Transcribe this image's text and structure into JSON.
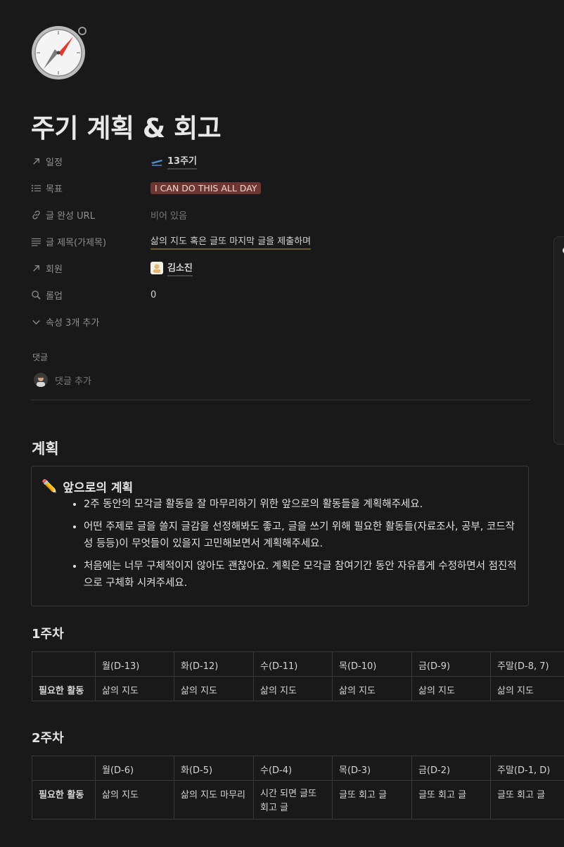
{
  "page": {
    "title": "주기 계획 & 회고"
  },
  "properties": [
    {
      "key": "일정",
      "icon": "arrow-upright-icon",
      "value": "13주기",
      "value_icon": "airplane-icon"
    },
    {
      "key": "목표",
      "icon": "list-icon",
      "value": "I CAN DO THIS ALL DAY"
    },
    {
      "key": "글 완성 URL",
      "icon": "link-icon",
      "value": "비어 있음"
    },
    {
      "key": "글 제목(가제목)",
      "icon": "text-lines-icon",
      "value": "삶의 지도 혹은 글또 마지막 글을 제출하며"
    },
    {
      "key": "회원",
      "icon": "arrow-upright-icon",
      "value": "김소진",
      "value_icon": "user-avatar-icon"
    },
    {
      "key": "롤업",
      "icon": "search-icon",
      "value": "0"
    }
  ],
  "more_properties": "속성 3개 추가",
  "comments": {
    "label": "댓글",
    "placeholder": "댓글 추가"
  },
  "plan": {
    "heading": "계획",
    "callout": {
      "emoji": "✏️",
      "title": "앞으로의 계획",
      "items": [
        "2주 동안의 모각글 활동을 잘 마무리하기 위한 앞으로의 활동들을 계획해주세요.",
        "어떤 주제로 글을 쓸지 글감을 선정해봐도 좋고, 글을 쓰기 위해 필요한 활동들(자료조사, 공부, 코드작성 등등)이 무엇들이 있을지 고민해보면서 계획해주세요.",
        "처음에는 너무 구체적이지 않아도 괜찮아요. 계획은 모각글 참여기간 동안 자유롭게 수정하면서 점진적으로 구체화 시켜주세요."
      ]
    }
  },
  "weeks": [
    {
      "heading": "1주차",
      "columns": [
        "",
        "월(D-13)",
        "화(D-12)",
        "수(D-11)",
        "목(D-10)",
        "금(D-9)",
        "주말(D-8, 7)"
      ],
      "row_label": "필요한 활동",
      "cells": [
        "삶의 지도",
        "삶의 지도",
        "삶의 지도",
        "삶의 지도",
        "삶의 지도",
        "삶의 지도"
      ]
    },
    {
      "heading": "2주차",
      "columns": [
        "",
        "월(D-6)",
        "화(D-5)",
        "수(D-4)",
        "목(D-3)",
        "금(D-2)",
        "주말(D-1, D)"
      ],
      "row_label": "필요한 활동",
      "cells": [
        "삶의 지도",
        "삶의 지도 마무리",
        "시간 되면 글또 회고 글",
        "글또 회고 글",
        "글또 회고 글",
        "글또 회고 글"
      ]
    }
  ],
  "colors": {
    "background": "#191919",
    "tag_background": "#6e3630",
    "underline": "#6b5a2a"
  }
}
